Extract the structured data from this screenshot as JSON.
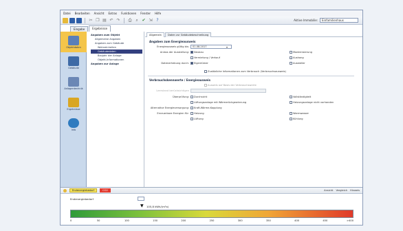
{
  "menu": [
    "Datei",
    "Bearbeiten",
    "Ansicht",
    "Extras",
    "Funktionen",
    "Fenster",
    "Hilfe"
  ],
  "toolbar": {
    "right_label": "Aktive Immobilie:",
    "right_value": "Einfamilienhaus"
  },
  "tabs": [
    "Eingabe",
    "Ergebnisse"
  ],
  "nav": [
    {
      "label": "Objektdaten",
      "icon": "house-icon",
      "color": "#5b7fb8"
    },
    {
      "label": "Gebäude",
      "icon": "building-icon",
      "color": "#3e6aa6"
    },
    {
      "label": "Anlagentechnik",
      "icon": "heating-icon",
      "color": "#6b87b5"
    },
    {
      "label": "Ergebnisse",
      "icon": "chart-icon",
      "color": "#d9a623"
    },
    {
      "label": "Info",
      "icon": "globe-icon",
      "color": "#2f7bbf"
    }
  ],
  "tree": [
    "Angaben zum Objekt",
    "Allgemeine Angaben",
    "Angaben zum Gebäude",
    "Wohneinheiten",
    "Gebäudedaten",
    "Baujahr der Anlage",
    "Objekt-Informationen",
    "Angaben zur Anlage"
  ],
  "subtabs": [
    "Allgemein",
    "Daten zur Gebäudebeschreibung"
  ],
  "main": {
    "section1": "Angaben zum Energieausweis",
    "ausstellung_label": "Energieausweis gültig bis:",
    "ausstellung_value": "01.08.2017",
    "anlass_label": "Anlass der Ausstellung:",
    "anlass": [
      {
        "label": "Neubau",
        "on": true
      },
      {
        "label": "Vermietung / Verkauf",
        "on": false
      },
      {
        "label": "Modernisierung",
        "on": false
      },
      {
        "label": "Aushang",
        "on": false
      }
    ],
    "datenerhebung_label": "Datenerhebung durch:",
    "datenerhebung": [
      {
        "label": "Eigentümer",
        "on": true
      },
      {
        "label": "Aussteller",
        "on": false
      }
    ],
    "zusatz_label": "Zusätzliche Informationen zum Verbrauch (Verbrauchsausweis)",
    "section2": "Verbrauchskennwerte / Energieausweis",
    "vk1_label": "Ausweis auf Basis der Verbrauchswerte",
    "vk2_label": "Leerstand berücksichtigen",
    "ueberpruefung_label": "Überprüfung:",
    "check_rows": [
      {
        "label": "Durchsicht",
        "on": false
      },
      {
        "label": "Vollständigkeit",
        "on": false
      },
      {
        "label": "Lüftungsanlage mit Wärmerückgewinnung",
        "on": false
      },
      {
        "label": "Heizungsanlage nicht vorhanden",
        "on": false
      }
    ],
    "energietraeger_label": "Alternative Energieversorgung:",
    "alt": [
      {
        "label": "Kraft-Wärme-Kopplung",
        "on": false
      }
    ],
    "erneuerbar_label": "Erneuerbare Energien für:",
    "ern": [
      {
        "label": "Heizung",
        "on": false
      },
      {
        "label": "Warmwasser",
        "on": false
      },
      {
        "label": "Lüftung",
        "on": false
      },
      {
        "label": "Kühlung",
        "on": false
      }
    ]
  },
  "bottom": {
    "pill1": "Endenergiebedarf",
    "pill2": "CO2",
    "right": [
      "Ansicht",
      "Vergleich",
      "Hinweis"
    ],
    "gauge_label": "Endenergiebedarf",
    "marker_label": "105,8 kWh/(m²a)",
    "ticks": [
      0,
      50,
      100,
      150,
      200,
      250,
      300,
      350,
      400,
      450,
      ">400"
    ],
    "marker_value": 105.8,
    "gauge_max": 400
  }
}
